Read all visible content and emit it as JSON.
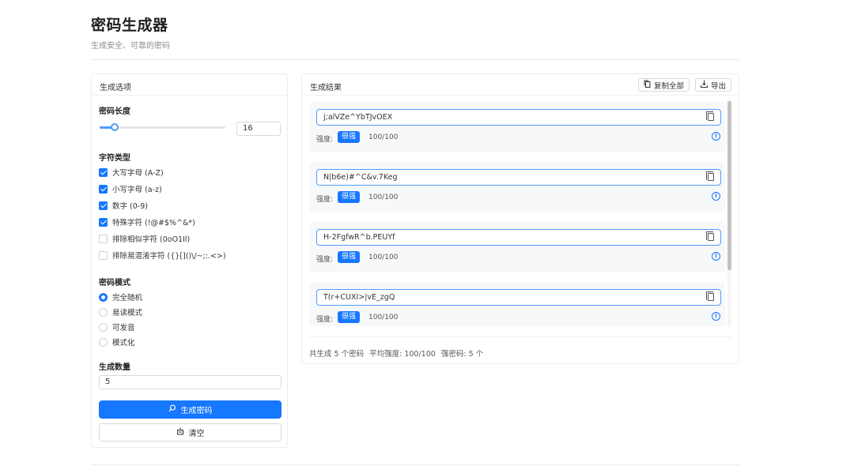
{
  "header": {
    "title": "密码生成器",
    "subtitle": "生成安全、可靠的密码"
  },
  "options": {
    "panel_title": "生成选项",
    "length": {
      "label": "密码长度",
      "value": "16",
      "slider_fraction": 0.12
    },
    "char_types": {
      "label": "字符类型",
      "items": [
        {
          "label": "大写字母 (A-Z)",
          "checked": true
        },
        {
          "label": "小写字母 (a-z)",
          "checked": true
        },
        {
          "label": "数字 (0-9)",
          "checked": true
        },
        {
          "label": "特殊字符 (!@#$%^&*)",
          "checked": true
        },
        {
          "label": "排除相似字符 (0oO1Il)",
          "checked": false
        },
        {
          "label": "排除易混淆字符 ({}[]()\\/~;:.<>)",
          "checked": false
        }
      ]
    },
    "mode": {
      "label": "密码模式",
      "items": [
        {
          "label": "完全随机",
          "selected": true
        },
        {
          "label": "易读模式",
          "selected": false
        },
        {
          "label": "可发音",
          "selected": false
        },
        {
          "label": "模式化",
          "selected": false
        }
      ]
    },
    "count": {
      "label": "生成数量",
      "value": "5"
    },
    "generate_label": "生成密码",
    "clear_label": "清空",
    "generate_icon": "search-icon",
    "clear_icon": "clear-icon"
  },
  "results": {
    "panel_title": "生成结果",
    "copy_all_label": "复制全部",
    "export_label": "导出",
    "strength_label": "强度:",
    "items": [
      {
        "password": "j;alVZe^YbTJvOEX",
        "strength": "很强",
        "score": "100/100"
      },
      {
        "password": "N|b6e)#^C&v.7Keg",
        "strength": "很强",
        "score": "100/100"
      },
      {
        "password": "H-2FgfwR^b.PEUYf",
        "strength": "很强",
        "score": "100/100"
      },
      {
        "password": "T(r+CUXI>|vE_zgQ",
        "strength": "很强",
        "score": "100/100"
      }
    ],
    "summary": {
      "total": "共生成 5 个密码",
      "average": "平均强度: 100/100",
      "strong": "强密码: 5 个"
    }
  },
  "colors": {
    "primary": "#1677ff",
    "slider": "#4d9dfb",
    "item_bg": "#f7f8fa"
  }
}
